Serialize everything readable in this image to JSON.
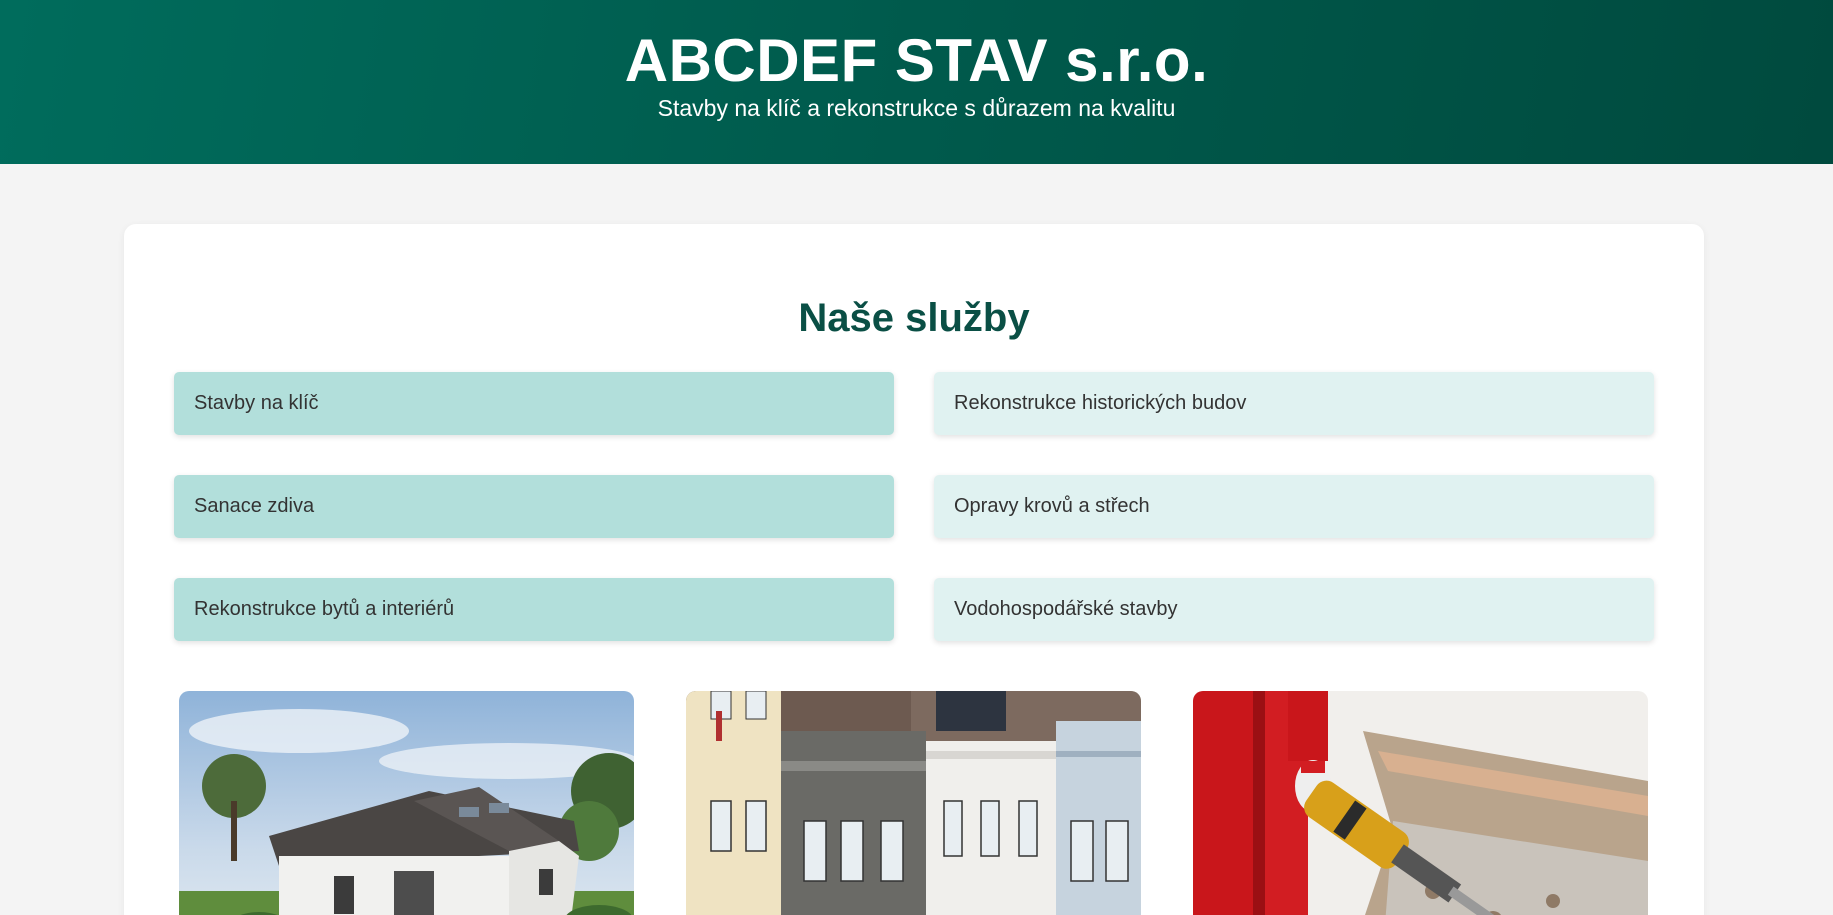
{
  "header": {
    "title": "ABCDEF STAV s.r.o.",
    "subtitle": "Stavby na klíč a rekonstrukce s důrazem na kvalitu",
    "colors": {
      "gradient_start": "#006c5c",
      "gradient_end": "#004a3e"
    }
  },
  "services": {
    "title": "Naše služby",
    "items": [
      {
        "label": "Stavby na klíč"
      },
      {
        "label": "Rekonstrukce historických budov"
      },
      {
        "label": "Sanace zdiva"
      },
      {
        "label": "Opravy krovů a střech"
      },
      {
        "label": "Rekonstrukce bytů a interiérů"
      },
      {
        "label": "Vodohospodářské stavby"
      }
    ],
    "colors": {
      "left": "#b2dfdb",
      "right": "#e0f2f1",
      "title": "#0a4f45"
    }
  },
  "gallery": {
    "images": [
      {
        "subject": "new-house-photo"
      },
      {
        "subject": "historic-buildings-photo"
      },
      {
        "subject": "demolition-worker-photo"
      }
    ]
  }
}
